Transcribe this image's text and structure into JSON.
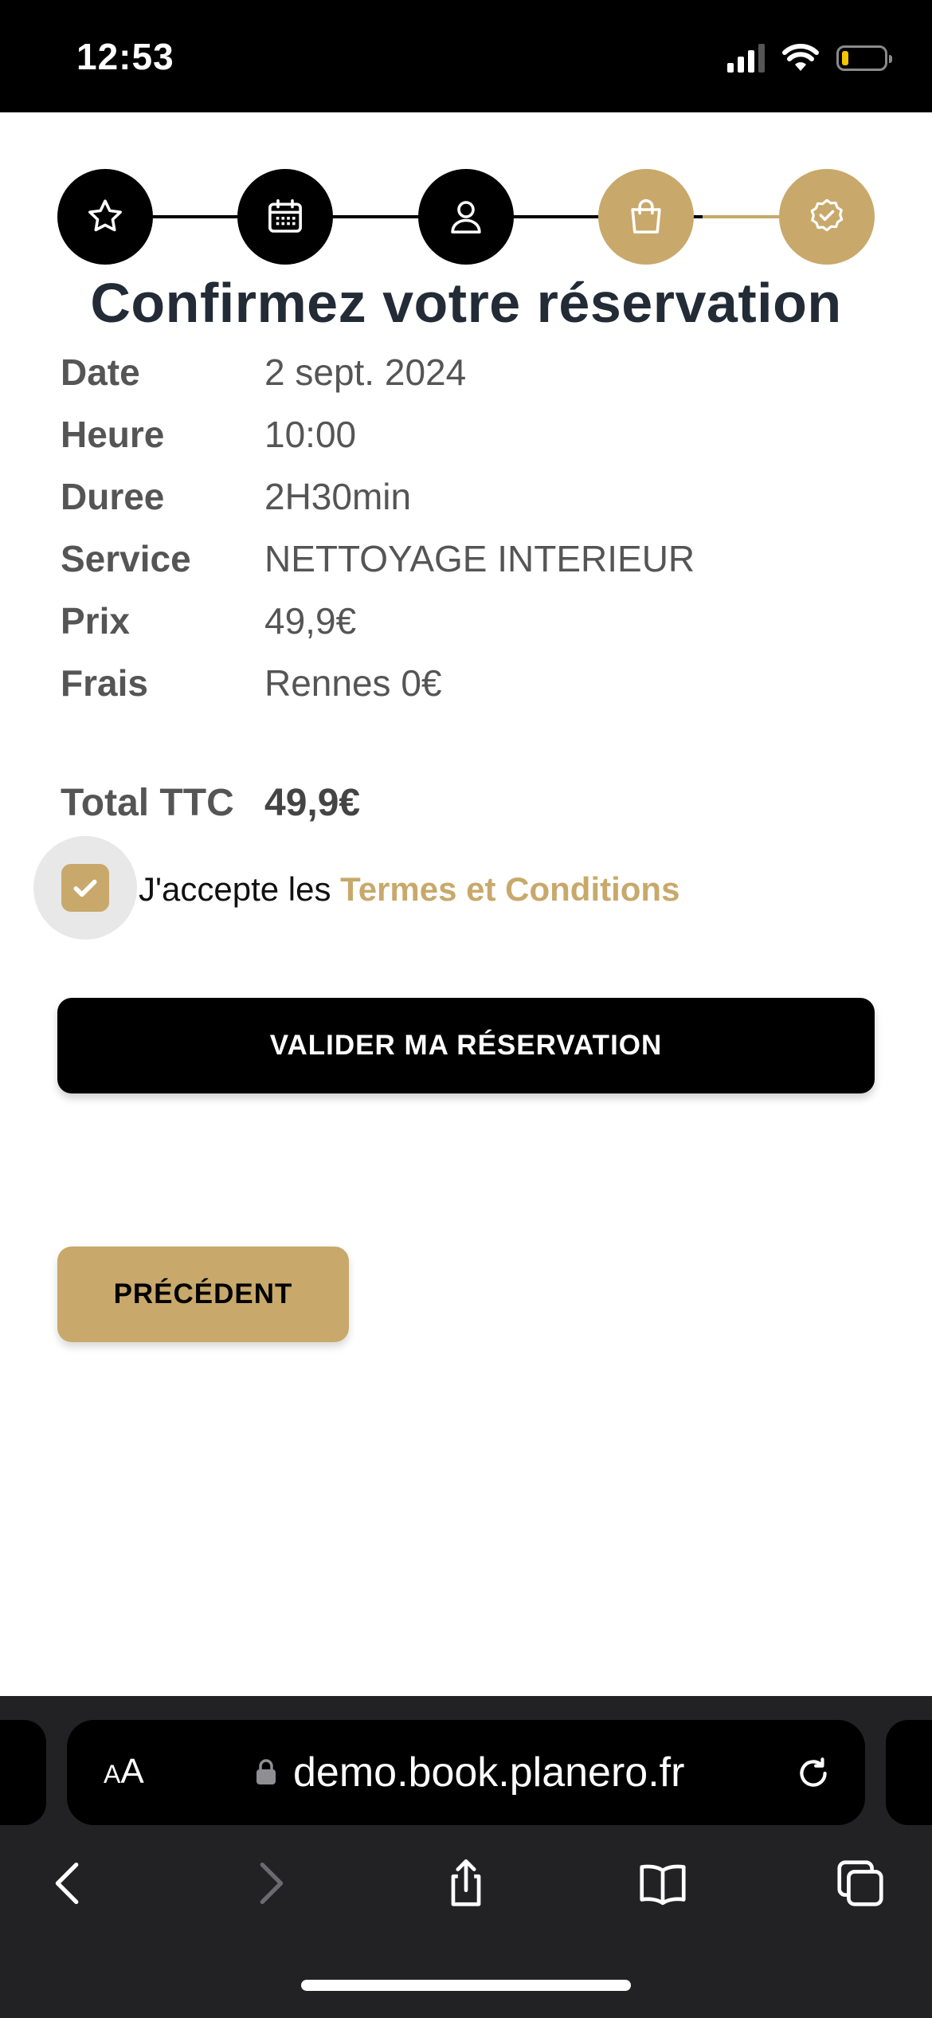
{
  "status_bar": {
    "time": "12:53"
  },
  "stepper": {
    "steps": [
      {
        "icon": "star-icon",
        "state": "completed"
      },
      {
        "icon": "calendar-icon",
        "state": "completed"
      },
      {
        "icon": "user-icon",
        "state": "completed"
      },
      {
        "icon": "shopping-bag-icon",
        "state": "current"
      },
      {
        "icon": "badge-check-icon",
        "state": "upcoming"
      }
    ]
  },
  "page": {
    "title": "Confirmez votre réservation"
  },
  "details": {
    "rows": [
      {
        "label": "Date",
        "value": "2 sept. 2024"
      },
      {
        "label": "Heure",
        "value": "10:00"
      },
      {
        "label": "Duree",
        "value": "2H30min"
      },
      {
        "label": "Service",
        "value": "NETTOYAGE INTERIEUR"
      },
      {
        "label": "Prix",
        "value": "49,9€"
      },
      {
        "label": "Frais",
        "value": "Rennes 0€"
      }
    ],
    "total": {
      "label": "Total TTC",
      "value": "49,9€"
    }
  },
  "terms": {
    "checked": true,
    "prefix": "J'accepte les ",
    "link": "Termes et Conditions"
  },
  "actions": {
    "validate": "VALIDER MA RÉSERVATION",
    "previous": "PRÉCÉDENT"
  },
  "browser": {
    "aa_small": "A",
    "aa_large": "A",
    "url": "demo.book.planero.fr"
  },
  "colors": {
    "gold": "#c8a96b",
    "dark": "#000000",
    "title": "#222b36"
  }
}
